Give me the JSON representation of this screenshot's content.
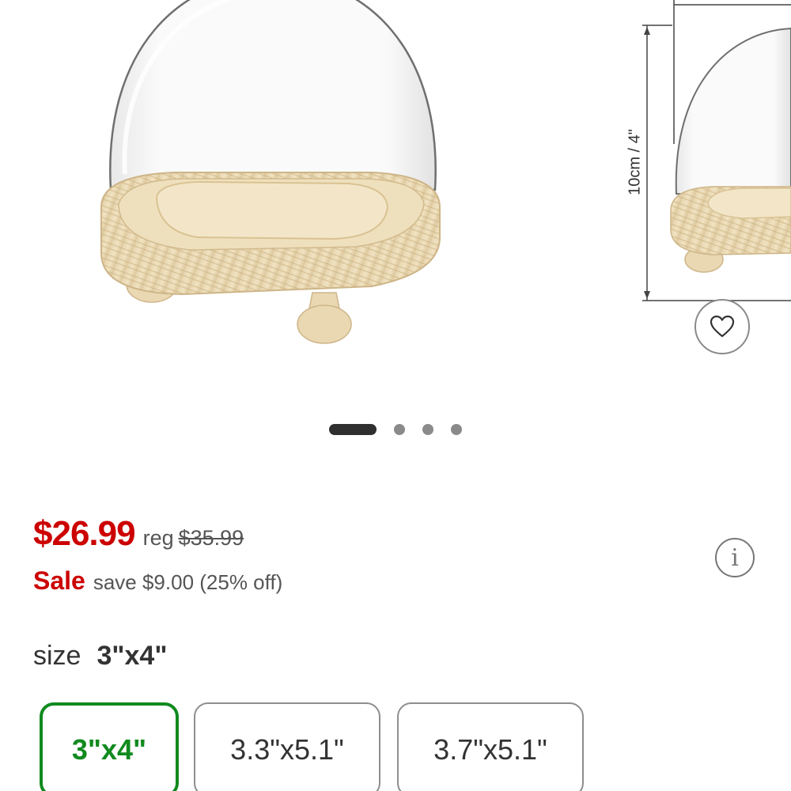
{
  "carousel": {
    "dimension_label": "10cm / 4\"",
    "total_slides": 4,
    "active_slide": 1
  },
  "favorite": {
    "icon": "heart-outline-icon"
  },
  "pricing": {
    "current_price": "$26.99",
    "reg_label": "reg",
    "reg_price": "$35.99",
    "sale_label": "Sale",
    "save_text": "save $9.00 (25% off)",
    "info_icon": "info-icon",
    "sale_color": "#cc0000"
  },
  "size": {
    "label": "size",
    "selected_value": "3\"x4\"",
    "options": [
      {
        "label": "3\"x4\"",
        "selected": true
      },
      {
        "label": "3.3\"x5.1\"",
        "selected": false
      },
      {
        "label": "3.7\"x5.1\"",
        "selected": false
      }
    ],
    "selected_color": "#118a1f"
  }
}
